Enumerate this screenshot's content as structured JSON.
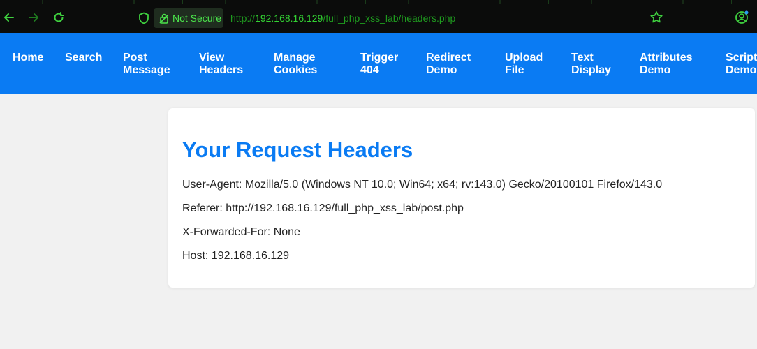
{
  "browser": {
    "security_label": "Not Secure",
    "url": {
      "scheme": "http://",
      "host": "192.168.16.129",
      "path": "/full_php_xss_lab/headers.php"
    },
    "accent_color": "#33d233",
    "icons": [
      "back-arrow-icon",
      "forward-arrow-icon",
      "reload-icon",
      "shield-icon",
      "lock-slash-icon",
      "bookmark-star-icon",
      "account-icon"
    ]
  },
  "nav": {
    "color": "#0a7bf3",
    "items": [
      {
        "label": "Home"
      },
      {
        "label": "Search"
      },
      {
        "label": "Post\nMessage"
      },
      {
        "label": "View\nHeaders"
      },
      {
        "label": "Manage\nCookies"
      },
      {
        "label": "Trigger\n404"
      },
      {
        "label": "Redirect\nDemo"
      },
      {
        "label": "Upload\nFile"
      },
      {
        "label": "Text\nDisplay"
      },
      {
        "label": "Attributes\nDemo"
      },
      {
        "label": "Script\nDemo"
      }
    ]
  },
  "content": {
    "title": "Your Request Headers",
    "headers": [
      "User-Agent: Mozilla/5.0 (Windows NT 10.0; Win64; x64; rv:143.0) Gecko/20100101 Firefox/143.0",
      "Referer: http://192.168.16.129/full_php_xss_lab/post.php",
      "X-Forwarded-For: None",
      "Host: 192.168.16.129"
    ]
  }
}
